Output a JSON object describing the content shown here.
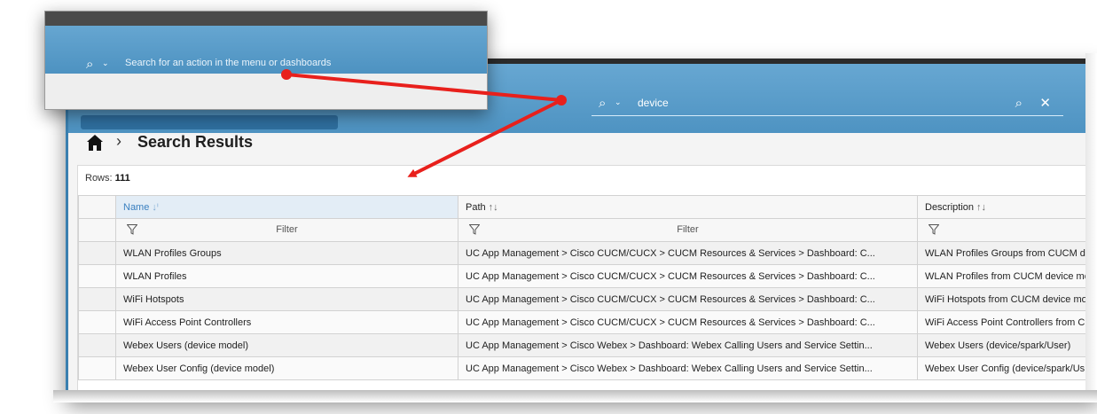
{
  "menu_search": {
    "placeholder": "Search for an action in the menu or dashboards"
  },
  "header_search": {
    "value": "device"
  },
  "breadcrumb": {
    "title": "Search Results"
  },
  "results": {
    "rows_label": "Rows:",
    "rows_count": "111",
    "filter_placeholder": "Filter",
    "columns": [
      {
        "label": "Name"
      },
      {
        "label": "Path"
      },
      {
        "label": "Description"
      }
    ],
    "rows": [
      {
        "name": "WLAN Profiles Groups",
        "path": "UC App Management > Cisco CUCM/CUCX > CUCM Resources & Services > Dashboard: C...",
        "description": "WLAN Profiles Groups from CUCM de"
      },
      {
        "name": "WLAN Profiles",
        "path": "UC App Management > Cisco CUCM/CUCX > CUCM Resources & Services > Dashboard: C...",
        "description": "WLAN Profiles from CUCM device mo"
      },
      {
        "name": "WiFi Hotspots",
        "path": "UC App Management > Cisco CUCM/CUCX > CUCM Resources & Services > Dashboard: C...",
        "description": "WiFi Hotspots from CUCM device mo"
      },
      {
        "name": "WiFi Access Point Controllers",
        "path": "UC App Management > Cisco CUCM/CUCX > CUCM Resources & Services > Dashboard: C...",
        "description": "WiFi Access Point Controllers from C"
      },
      {
        "name": "Webex Users (device model)",
        "path": "UC App Management > Cisco Webex > Dashboard: Webex Calling Users and Service Settin...",
        "description": "Webex Users (device/spark/User)"
      },
      {
        "name": "Webex User Config (device model)",
        "path": "UC App Management > Cisco Webex > Dashboard: Webex Calling Users and Service Settin...",
        "description": "Webex User Config (device/spark/Us"
      }
    ]
  },
  "colors": {
    "header_blue": "#4e93c2",
    "arrow_red": "#e8201c",
    "sorted_header_text": "#3a80c0"
  }
}
